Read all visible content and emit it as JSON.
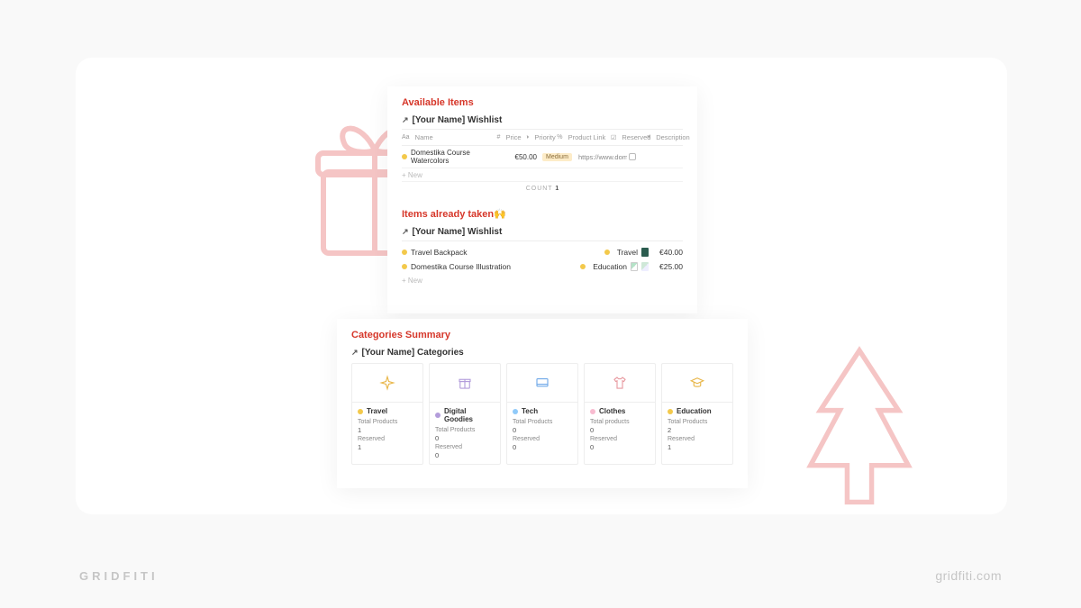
{
  "brand": {
    "name": "GRIDFITI",
    "url": "gridfiti.com"
  },
  "available": {
    "title": "Available Items",
    "subtitle": "[Your Name] Wishlist",
    "columns": {
      "name": "Name",
      "price": "Price",
      "priority": "Priority",
      "link": "Product Link",
      "reserved": "Reserved",
      "description": "Description"
    },
    "rows": [
      {
        "name": "Domestika Course Watercolors",
        "price": "€50.00",
        "priority": "Medium",
        "link": "https://www.domes"
      }
    ],
    "new_label": "+  New",
    "count_label": "COUNT",
    "count_value": "1"
  },
  "taken": {
    "title": "Items already taken🙌",
    "subtitle": "[Your Name] Wishlist",
    "rows": [
      {
        "name": "Travel Backpack",
        "category": "Travel",
        "price": "€40.00"
      },
      {
        "name": "Domestika Course Illustration",
        "category": "Education",
        "price": "€25.00"
      }
    ],
    "new_label": "+  New"
  },
  "summary": {
    "title": "Categories Summary",
    "subtitle": "[Your Name] Categories",
    "labels": {
      "total": "Total Products",
      "total_alt": "Total products",
      "reserved": "Reserved"
    },
    "cards": [
      {
        "name": "Travel",
        "dot": "yellow",
        "icon": "plane",
        "total": "1",
        "reserved": "1"
      },
      {
        "name": "Digital Goodies",
        "dot": "purple",
        "icon": "gift",
        "total": "0",
        "reserved": "0"
      },
      {
        "name": "Tech",
        "dot": "blue",
        "icon": "device",
        "total": "0",
        "reserved": "0"
      },
      {
        "name": "Clothes",
        "dot": "pink",
        "icon": "shirt",
        "total_label": "alt",
        "total": "0",
        "reserved": "0"
      },
      {
        "name": "Education",
        "dot": "yellow",
        "icon": "cap",
        "total": "2",
        "reserved": "1"
      }
    ]
  }
}
